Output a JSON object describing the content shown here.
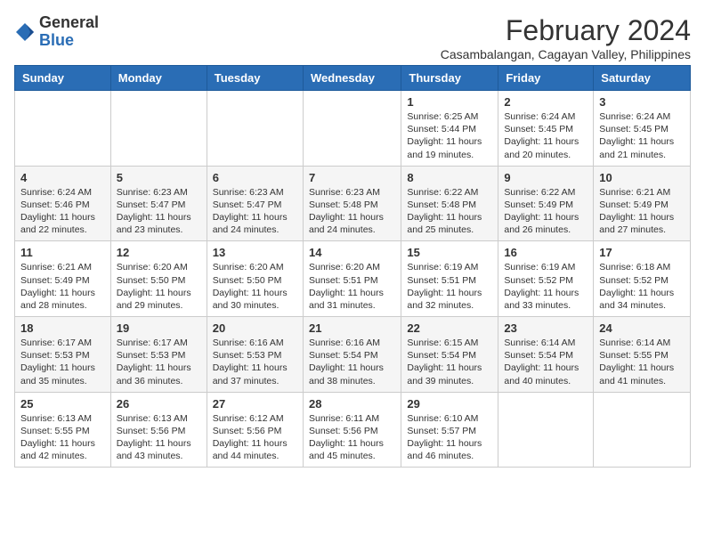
{
  "logo": {
    "general": "General",
    "blue": "Blue"
  },
  "header": {
    "month_year": "February 2024",
    "subtitle": "Casambalangan, Cagayan Valley, Philippines"
  },
  "days_of_week": [
    "Sunday",
    "Monday",
    "Tuesday",
    "Wednesday",
    "Thursday",
    "Friday",
    "Saturday"
  ],
  "weeks": [
    [
      {
        "day": "",
        "info": ""
      },
      {
        "day": "",
        "info": ""
      },
      {
        "day": "",
        "info": ""
      },
      {
        "day": "",
        "info": ""
      },
      {
        "day": "1",
        "info": "Sunrise: 6:25 AM\nSunset: 5:44 PM\nDaylight: 11 hours and 19 minutes."
      },
      {
        "day": "2",
        "info": "Sunrise: 6:24 AM\nSunset: 5:45 PM\nDaylight: 11 hours and 20 minutes."
      },
      {
        "day": "3",
        "info": "Sunrise: 6:24 AM\nSunset: 5:45 PM\nDaylight: 11 hours and 21 minutes."
      }
    ],
    [
      {
        "day": "4",
        "info": "Sunrise: 6:24 AM\nSunset: 5:46 PM\nDaylight: 11 hours and 22 minutes."
      },
      {
        "day": "5",
        "info": "Sunrise: 6:23 AM\nSunset: 5:47 PM\nDaylight: 11 hours and 23 minutes."
      },
      {
        "day": "6",
        "info": "Sunrise: 6:23 AM\nSunset: 5:47 PM\nDaylight: 11 hours and 24 minutes."
      },
      {
        "day": "7",
        "info": "Sunrise: 6:23 AM\nSunset: 5:48 PM\nDaylight: 11 hours and 24 minutes."
      },
      {
        "day": "8",
        "info": "Sunrise: 6:22 AM\nSunset: 5:48 PM\nDaylight: 11 hours and 25 minutes."
      },
      {
        "day": "9",
        "info": "Sunrise: 6:22 AM\nSunset: 5:49 PM\nDaylight: 11 hours and 26 minutes."
      },
      {
        "day": "10",
        "info": "Sunrise: 6:21 AM\nSunset: 5:49 PM\nDaylight: 11 hours and 27 minutes."
      }
    ],
    [
      {
        "day": "11",
        "info": "Sunrise: 6:21 AM\nSunset: 5:49 PM\nDaylight: 11 hours and 28 minutes."
      },
      {
        "day": "12",
        "info": "Sunrise: 6:20 AM\nSunset: 5:50 PM\nDaylight: 11 hours and 29 minutes."
      },
      {
        "day": "13",
        "info": "Sunrise: 6:20 AM\nSunset: 5:50 PM\nDaylight: 11 hours and 30 minutes."
      },
      {
        "day": "14",
        "info": "Sunrise: 6:20 AM\nSunset: 5:51 PM\nDaylight: 11 hours and 31 minutes."
      },
      {
        "day": "15",
        "info": "Sunrise: 6:19 AM\nSunset: 5:51 PM\nDaylight: 11 hours and 32 minutes."
      },
      {
        "day": "16",
        "info": "Sunrise: 6:19 AM\nSunset: 5:52 PM\nDaylight: 11 hours and 33 minutes."
      },
      {
        "day": "17",
        "info": "Sunrise: 6:18 AM\nSunset: 5:52 PM\nDaylight: 11 hours and 34 minutes."
      }
    ],
    [
      {
        "day": "18",
        "info": "Sunrise: 6:17 AM\nSunset: 5:53 PM\nDaylight: 11 hours and 35 minutes."
      },
      {
        "day": "19",
        "info": "Sunrise: 6:17 AM\nSunset: 5:53 PM\nDaylight: 11 hours and 36 minutes."
      },
      {
        "day": "20",
        "info": "Sunrise: 6:16 AM\nSunset: 5:53 PM\nDaylight: 11 hours and 37 minutes."
      },
      {
        "day": "21",
        "info": "Sunrise: 6:16 AM\nSunset: 5:54 PM\nDaylight: 11 hours and 38 minutes."
      },
      {
        "day": "22",
        "info": "Sunrise: 6:15 AM\nSunset: 5:54 PM\nDaylight: 11 hours and 39 minutes."
      },
      {
        "day": "23",
        "info": "Sunrise: 6:14 AM\nSunset: 5:54 PM\nDaylight: 11 hours and 40 minutes."
      },
      {
        "day": "24",
        "info": "Sunrise: 6:14 AM\nSunset: 5:55 PM\nDaylight: 11 hours and 41 minutes."
      }
    ],
    [
      {
        "day": "25",
        "info": "Sunrise: 6:13 AM\nSunset: 5:55 PM\nDaylight: 11 hours and 42 minutes."
      },
      {
        "day": "26",
        "info": "Sunrise: 6:13 AM\nSunset: 5:56 PM\nDaylight: 11 hours and 43 minutes."
      },
      {
        "day": "27",
        "info": "Sunrise: 6:12 AM\nSunset: 5:56 PM\nDaylight: 11 hours and 44 minutes."
      },
      {
        "day": "28",
        "info": "Sunrise: 6:11 AM\nSunset: 5:56 PM\nDaylight: 11 hours and 45 minutes."
      },
      {
        "day": "29",
        "info": "Sunrise: 6:10 AM\nSunset: 5:57 PM\nDaylight: 11 hours and 46 minutes."
      },
      {
        "day": "",
        "info": ""
      },
      {
        "day": "",
        "info": ""
      }
    ]
  ]
}
